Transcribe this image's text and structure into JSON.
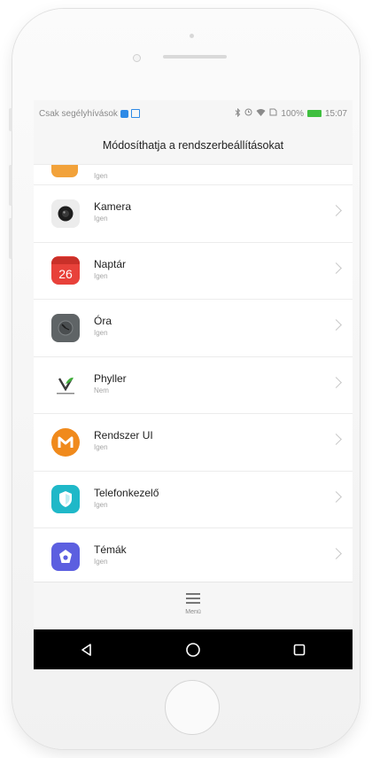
{
  "status_bar": {
    "carrier_text": "Csak segélyhívások",
    "battery_percent": "100%",
    "time": "15:07",
    "battery_color": "#3fbf3f"
  },
  "header": {
    "title": "Módosíthatja a rendszerbeállításokat"
  },
  "list": {
    "peek_item": {
      "sub": "Igen",
      "icon_color": "#f2a23a"
    },
    "items": [
      {
        "name": "Kamera",
        "sub": "Igen",
        "icon": "camera-icon",
        "icon_bg": "#eeeeee"
      },
      {
        "name": "Naptár",
        "sub": "Igen",
        "icon": "calendar-icon",
        "icon_bg": "#e8413a",
        "icon_text": "26"
      },
      {
        "name": "Óra",
        "sub": "Igen",
        "icon": "clock-icon",
        "icon_bg": "#5f6466"
      },
      {
        "name": "Phyller",
        "sub": "Nem",
        "icon": "phyller-icon",
        "icon_bg": "#ffffff"
      },
      {
        "name": "Rendszer UI",
        "sub": "Igen",
        "icon": "system-ui-icon",
        "icon_bg": "#f08a1c"
      },
      {
        "name": "Telefonkezelő",
        "sub": "Igen",
        "icon": "phone-manager-shield-icon",
        "icon_bg": "#1fb8c8"
      },
      {
        "name": "Témák",
        "sub": "Igen",
        "icon": "themes-icon",
        "icon_bg": "#5c5fe0"
      }
    ]
  },
  "bottom": {
    "menu_label": "Menü"
  }
}
